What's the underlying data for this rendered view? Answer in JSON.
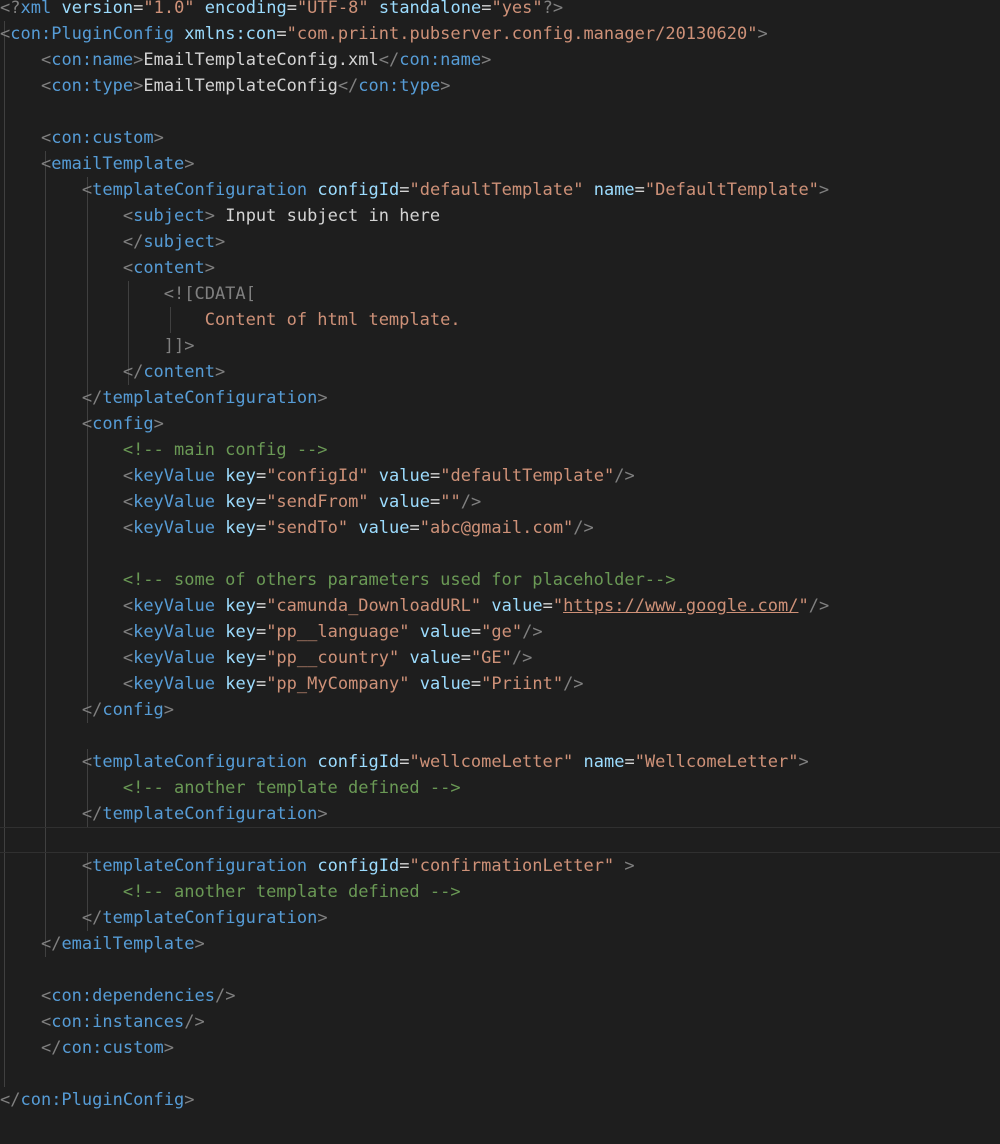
{
  "theme": {
    "background": "#1e1e1e",
    "tag_bracket": "#808080",
    "tag_name": "#569cd6",
    "attribute": "#9cdcfe",
    "value": "#ce9178",
    "text": "#d4d4d4",
    "comment": "#6a9955"
  },
  "lines": [
    [
      [
        "tag-b",
        "<?"
      ],
      [
        "tag-n",
        "xml"
      ],
      [
        "txt",
        " "
      ],
      [
        "attr",
        "version"
      ],
      [
        "txt",
        "="
      ],
      [
        "val",
        "\"1.0\""
      ],
      [
        "txt",
        " "
      ],
      [
        "attr",
        "encoding"
      ],
      [
        "txt",
        "="
      ],
      [
        "val",
        "\"UTF-8\""
      ],
      [
        "txt",
        " "
      ],
      [
        "attr",
        "standalone"
      ],
      [
        "txt",
        "="
      ],
      [
        "val",
        "\"yes\""
      ],
      [
        "tag-b",
        "?>"
      ]
    ],
    [
      [
        "tag-b",
        "<"
      ],
      [
        "tag-n",
        "con:PluginConfig"
      ],
      [
        "txt",
        " "
      ],
      [
        "attr",
        "xmlns:con"
      ],
      [
        "txt",
        "="
      ],
      [
        "val",
        "\"com.priint.pubserver.config.manager/20130620\""
      ],
      [
        "tag-b",
        ">"
      ]
    ],
    [
      [
        "txt",
        "    "
      ],
      [
        "tag-b",
        "<"
      ],
      [
        "tag-n",
        "con:name"
      ],
      [
        "tag-b",
        ">"
      ],
      [
        "txt",
        "EmailTemplateConfig.xml"
      ],
      [
        "tag-b",
        "</"
      ],
      [
        "tag-n",
        "con:name"
      ],
      [
        "tag-b",
        ">"
      ]
    ],
    [
      [
        "txt",
        "    "
      ],
      [
        "tag-b",
        "<"
      ],
      [
        "tag-n",
        "con:type"
      ],
      [
        "tag-b",
        ">"
      ],
      [
        "txt",
        "EmailTemplateConfig"
      ],
      [
        "tag-b",
        "</"
      ],
      [
        "tag-n",
        "con:type"
      ],
      [
        "tag-b",
        ">"
      ]
    ],
    [],
    [
      [
        "txt",
        "    "
      ],
      [
        "tag-b",
        "<"
      ],
      [
        "tag-n",
        "con:custom"
      ],
      [
        "tag-b",
        ">"
      ]
    ],
    [
      [
        "txt",
        "    "
      ],
      [
        "tag-b",
        "<"
      ],
      [
        "tag-n",
        "emailTemplate"
      ],
      [
        "tag-b",
        ">"
      ]
    ],
    [
      [
        "txt",
        "        "
      ],
      [
        "tag-b",
        "<"
      ],
      [
        "tag-n",
        "templateConfiguration"
      ],
      [
        "txt",
        " "
      ],
      [
        "attr",
        "configId"
      ],
      [
        "txt",
        "="
      ],
      [
        "val",
        "\"defaultTemplate\""
      ],
      [
        "txt",
        " "
      ],
      [
        "attr",
        "name"
      ],
      [
        "txt",
        "="
      ],
      [
        "val",
        "\"DefaultTemplate\""
      ],
      [
        "tag-b",
        ">"
      ]
    ],
    [
      [
        "txt",
        "            "
      ],
      [
        "tag-b",
        "<"
      ],
      [
        "tag-n",
        "subject"
      ],
      [
        "tag-b",
        ">"
      ],
      [
        "txt",
        " Input subject in here"
      ]
    ],
    [
      [
        "txt",
        "            "
      ],
      [
        "tag-b",
        "</"
      ],
      [
        "tag-n",
        "subject"
      ],
      [
        "tag-b",
        ">"
      ]
    ],
    [
      [
        "txt",
        "            "
      ],
      [
        "tag-b",
        "<"
      ],
      [
        "tag-n",
        "content"
      ],
      [
        "tag-b",
        ">"
      ]
    ],
    [
      [
        "txt",
        "                "
      ],
      [
        "cdata-b",
        "<![CDATA["
      ]
    ],
    [
      [
        "txt",
        "                    "
      ],
      [
        "val",
        "Content of html template."
      ]
    ],
    [
      [
        "txt",
        "                "
      ],
      [
        "cdata-b",
        "]]>"
      ]
    ],
    [
      [
        "txt",
        "            "
      ],
      [
        "tag-b",
        "</"
      ],
      [
        "tag-n",
        "content"
      ],
      [
        "tag-b",
        ">"
      ]
    ],
    [
      [
        "txt",
        "        "
      ],
      [
        "tag-b",
        "</"
      ],
      [
        "tag-n",
        "templateConfiguration"
      ],
      [
        "tag-b",
        ">"
      ]
    ],
    [
      [
        "txt",
        "        "
      ],
      [
        "tag-b",
        "<"
      ],
      [
        "tag-n",
        "config"
      ],
      [
        "tag-b",
        ">"
      ]
    ],
    [
      [
        "txt",
        "            "
      ],
      [
        "cmt",
        "<!-- main config -->"
      ]
    ],
    [
      [
        "txt",
        "            "
      ],
      [
        "tag-b",
        "<"
      ],
      [
        "tag-n",
        "keyValue"
      ],
      [
        "txt",
        " "
      ],
      [
        "attr",
        "key"
      ],
      [
        "txt",
        "="
      ],
      [
        "val",
        "\"configId\""
      ],
      [
        "txt",
        " "
      ],
      [
        "attr",
        "value"
      ],
      [
        "txt",
        "="
      ],
      [
        "val",
        "\"defaultTemplate\""
      ],
      [
        "tag-b",
        "/>"
      ]
    ],
    [
      [
        "txt",
        "            "
      ],
      [
        "tag-b",
        "<"
      ],
      [
        "tag-n",
        "keyValue"
      ],
      [
        "txt",
        " "
      ],
      [
        "attr",
        "key"
      ],
      [
        "txt",
        "="
      ],
      [
        "val",
        "\"sendFrom\""
      ],
      [
        "txt",
        " "
      ],
      [
        "attr",
        "value"
      ],
      [
        "txt",
        "="
      ],
      [
        "val",
        "\"\""
      ],
      [
        "tag-b",
        "/>"
      ]
    ],
    [
      [
        "txt",
        "            "
      ],
      [
        "tag-b",
        "<"
      ],
      [
        "tag-n",
        "keyValue"
      ],
      [
        "txt",
        " "
      ],
      [
        "attr",
        "key"
      ],
      [
        "txt",
        "="
      ],
      [
        "val",
        "\"sendTo\""
      ],
      [
        "txt",
        " "
      ],
      [
        "attr",
        "value"
      ],
      [
        "txt",
        "="
      ],
      [
        "val",
        "\"abc@gmail.com\""
      ],
      [
        "tag-b",
        "/>"
      ]
    ],
    [],
    [
      [
        "txt",
        "            "
      ],
      [
        "cmt",
        "<!-- some of others parameters used for placeholder-->"
      ]
    ],
    [
      [
        "txt",
        "            "
      ],
      [
        "tag-b",
        "<"
      ],
      [
        "tag-n",
        "keyValue"
      ],
      [
        "txt",
        " "
      ],
      [
        "attr",
        "key"
      ],
      [
        "txt",
        "="
      ],
      [
        "val",
        "\"camunda_DownloadURL\""
      ],
      [
        "txt",
        " "
      ],
      [
        "attr",
        "value"
      ],
      [
        "txt",
        "="
      ],
      [
        "val",
        "\""
      ],
      [
        "val link",
        "https://www.google.com/"
      ],
      [
        "val",
        "\""
      ],
      [
        "tag-b",
        "/>"
      ]
    ],
    [
      [
        "txt",
        "            "
      ],
      [
        "tag-b",
        "<"
      ],
      [
        "tag-n",
        "keyValue"
      ],
      [
        "txt",
        " "
      ],
      [
        "attr",
        "key"
      ],
      [
        "txt",
        "="
      ],
      [
        "val",
        "\"pp__language\""
      ],
      [
        "txt",
        " "
      ],
      [
        "attr",
        "value"
      ],
      [
        "txt",
        "="
      ],
      [
        "val",
        "\"ge\""
      ],
      [
        "tag-b",
        "/>"
      ]
    ],
    [
      [
        "txt",
        "            "
      ],
      [
        "tag-b",
        "<"
      ],
      [
        "tag-n",
        "keyValue"
      ],
      [
        "txt",
        " "
      ],
      [
        "attr",
        "key"
      ],
      [
        "txt",
        "="
      ],
      [
        "val",
        "\"pp__country\""
      ],
      [
        "txt",
        " "
      ],
      [
        "attr",
        "value"
      ],
      [
        "txt",
        "="
      ],
      [
        "val",
        "\"GE\""
      ],
      [
        "tag-b",
        "/>"
      ]
    ],
    [
      [
        "txt",
        "            "
      ],
      [
        "tag-b",
        "<"
      ],
      [
        "tag-n",
        "keyValue"
      ],
      [
        "txt",
        " "
      ],
      [
        "attr",
        "key"
      ],
      [
        "txt",
        "="
      ],
      [
        "val",
        "\"pp_MyCompany\""
      ],
      [
        "txt",
        " "
      ],
      [
        "attr",
        "value"
      ],
      [
        "txt",
        "="
      ],
      [
        "val",
        "\"Priint\""
      ],
      [
        "tag-b",
        "/>"
      ]
    ],
    [
      [
        "txt",
        "        "
      ],
      [
        "tag-b",
        "</"
      ],
      [
        "tag-n",
        "config"
      ],
      [
        "tag-b",
        ">"
      ]
    ],
    [],
    [
      [
        "txt",
        "        "
      ],
      [
        "tag-b",
        "<"
      ],
      [
        "tag-n",
        "templateConfiguration"
      ],
      [
        "txt",
        " "
      ],
      [
        "attr",
        "configId"
      ],
      [
        "txt",
        "="
      ],
      [
        "val",
        "\"wellcomeLetter\""
      ],
      [
        "txt",
        " "
      ],
      [
        "attr",
        "name"
      ],
      [
        "txt",
        "="
      ],
      [
        "val",
        "\"WellcomeLetter\""
      ],
      [
        "tag-b",
        ">"
      ]
    ],
    [
      [
        "txt",
        "            "
      ],
      [
        "cmt",
        "<!-- another template defined -->"
      ]
    ],
    [
      [
        "txt",
        "        "
      ],
      [
        "tag-b",
        "</"
      ],
      [
        "tag-n",
        "templateConfiguration"
      ],
      [
        "tag-b",
        ">"
      ]
    ],
    [],
    [
      [
        "txt",
        "        "
      ],
      [
        "tag-b",
        "<"
      ],
      [
        "tag-n",
        "templateConfiguration"
      ],
      [
        "txt",
        " "
      ],
      [
        "attr",
        "configId"
      ],
      [
        "txt",
        "="
      ],
      [
        "val",
        "\"confirmationLetter\""
      ],
      [
        "txt",
        " "
      ],
      [
        "tag-b",
        ">"
      ]
    ],
    [
      [
        "txt",
        "            "
      ],
      [
        "cmt",
        "<!-- another template defined -->"
      ]
    ],
    [
      [
        "txt",
        "        "
      ],
      [
        "tag-b",
        "</"
      ],
      [
        "tag-n",
        "templateConfiguration"
      ],
      [
        "tag-b",
        ">"
      ]
    ],
    [
      [
        "txt",
        "    "
      ],
      [
        "tag-b",
        "</"
      ],
      [
        "tag-n",
        "emailTemplate"
      ],
      [
        "tag-b",
        ">"
      ]
    ],
    [],
    [
      [
        "txt",
        "    "
      ],
      [
        "tag-b",
        "<"
      ],
      [
        "tag-n",
        "con:dependencies"
      ],
      [
        "tag-b",
        "/>"
      ]
    ],
    [
      [
        "txt",
        "    "
      ],
      [
        "tag-b",
        "<"
      ],
      [
        "tag-n",
        "con:instances"
      ],
      [
        "tag-b",
        "/>"
      ]
    ],
    [
      [
        "txt",
        "    "
      ],
      [
        "tag-b",
        "</"
      ],
      [
        "tag-n",
        "con:custom"
      ],
      [
        "tag-b",
        ">"
      ]
    ],
    [],
    [
      [
        "tag-b",
        "</"
      ],
      [
        "tag-n",
        "con:PluginConfig"
      ],
      [
        "tag-b",
        ">"
      ]
    ]
  ]
}
